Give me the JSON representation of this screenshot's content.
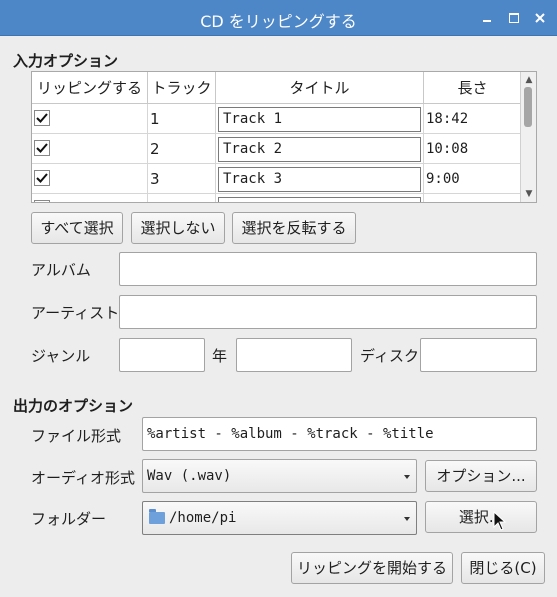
{
  "window": {
    "title": "CD をリッピングする"
  },
  "input_section": {
    "title": "入力オプション"
  },
  "table": {
    "headers": [
      "リッピングする",
      "トラック",
      "タイトル",
      "長さ"
    ],
    "rows": [
      {
        "rip": true,
        "track": "1",
        "title": "Track 1",
        "length": "18:42"
      },
      {
        "rip": true,
        "track": "2",
        "title": "Track 2",
        "length": "10:08"
      },
      {
        "rip": true,
        "track": "3",
        "title": "Track 3",
        "length": "9:00"
      }
    ]
  },
  "selection_buttons": {
    "select_all": "すべて選択",
    "select_none": "選択しない",
    "invert": "選択を反転する"
  },
  "meta": {
    "album_label": "アルバム",
    "album_value": "",
    "artist_label": "アーティスト",
    "artist_value": "",
    "genre_label": "ジャンル",
    "genre_value": "",
    "year_label": "年",
    "year_value": "",
    "disc_label": "ディスク",
    "disc_value": ""
  },
  "output_section": {
    "title": "出力のオプション",
    "file_format_label": "ファイル形式",
    "file_format_value": "%artist - %album - %track - %title",
    "audio_format_label": "オーディオ形式",
    "audio_format_value": "Wav (.wav)",
    "options_button": "オプション...",
    "folder_label": "フォルダー",
    "folder_value": "/home/pi",
    "browse_button": "選択..."
  },
  "footer": {
    "start_button": "リッピングを開始する",
    "close_button": "閉じる(C)"
  },
  "icons": {
    "checkbox": "checkmark-icon",
    "folder": "folder-icon",
    "min": "minimize-icon",
    "max": "maximize-icon",
    "close": "close-icon"
  }
}
